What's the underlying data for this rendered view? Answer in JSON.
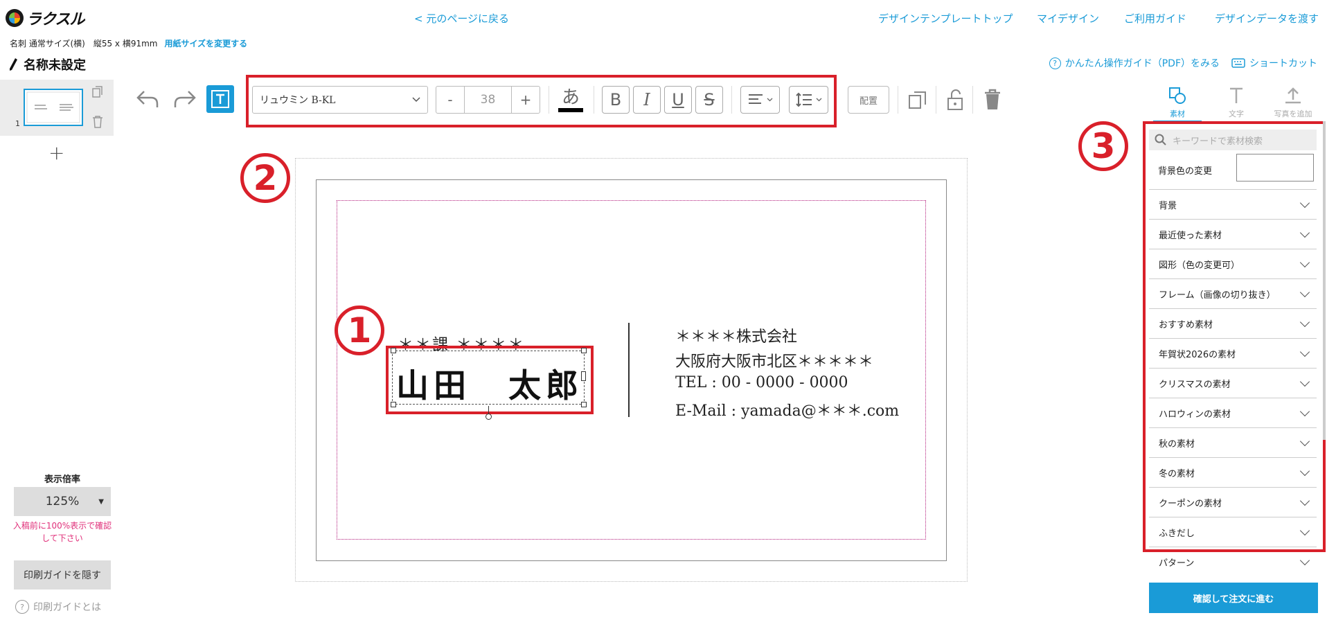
{
  "header": {
    "logo_text": "ラクスル",
    "back_link": "< 元のページに戻る",
    "nav": [
      "デザインテンプレートトップ",
      "マイデザイン",
      "ご利用ガイド",
      "デザインデータを渡す"
    ],
    "size_info": "名刺 通常サイズ(横)　縦55 x 横91mm",
    "size_change": "用紙サイズを変更する",
    "doc_title": "名称未設定",
    "guide_pdf": "かんたん操作ガイド（PDF）をみる",
    "shortcut": "ショートカット"
  },
  "pages": {
    "page_number": "1",
    "add": "+"
  },
  "toolbar": {
    "font_name": "リュウミン B-KL",
    "font_size": "38",
    "minus": "-",
    "plus": "+",
    "color_glyph": "あ",
    "bold": "B",
    "italic": "I",
    "underline": "U",
    "strike": "S",
    "arrange": "配置",
    "text_color": "#000000"
  },
  "card": {
    "dept": "＊＊課 ＊＊＊＊",
    "name": "山田　太郎",
    "company": "＊＊＊＊株式会社",
    "address": "大阪府大阪市北区＊＊＊＊＊",
    "tel": "TEL : 00 - 0000 - 0000",
    "email": "E-Mail : yamada@＊＊＊.com"
  },
  "annotations": {
    "one": "1",
    "two": "2",
    "three": "3",
    "color": "#d9202a"
  },
  "zoom": {
    "label": "表示倍率",
    "value": "125%",
    "note": "入稿前に100%表示で確認して下さい",
    "hide_guide": "印刷ガイドを隠す",
    "what_guide": "印刷ガイドとは"
  },
  "right_panel": {
    "tabs": [
      {
        "label": "素材",
        "icon": "material-icon",
        "active": true
      },
      {
        "label": "文字",
        "icon": "text-icon",
        "active": false
      },
      {
        "label": "写真を追加",
        "icon": "upload-icon",
        "active": false
      }
    ],
    "search_placeholder": "キーワードで素材検索",
    "bg_color_label": "背景色の変更",
    "categories": [
      "背景",
      "最近使った素材",
      "図形（色の変更可）",
      "フレーム（画像の切り抜き）",
      "おすすめ素材",
      "年賀状2026の素材",
      "クリスマスの素材",
      "ハロウィンの素材",
      "秋の素材",
      "冬の素材",
      "クーポンの素材",
      "ふきだし",
      "パターン"
    ],
    "confirm": "確認して注文に進む",
    "accent": "#1a9bd7"
  }
}
